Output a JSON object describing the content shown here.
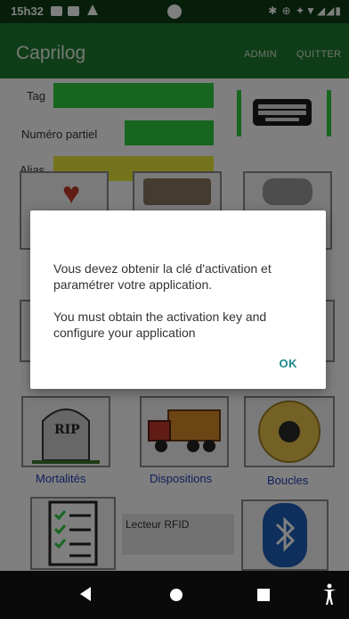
{
  "status_bar": {
    "time": "15h32"
  },
  "app_bar": {
    "title": "Caprilog",
    "admin_label": "ADMIN",
    "quit_label": "QUITTER"
  },
  "form": {
    "tag_label": "Tag",
    "partial_number_label": "Numéro partiel",
    "alias_label": "Alias"
  },
  "tiles": {
    "mortalities_label": "Mortalités",
    "dispositions_label": "Dispositions",
    "loops_label": "Boucles",
    "rfid_reader_label": "Lecteur RFID",
    "rip_text": "RIP"
  },
  "dialog": {
    "message_fr": "Vous devez obtenir la clé d'activation et paramétrer votre application.",
    "message_en": "You must obtain the activation key and configure your application",
    "ok_label": "OK"
  },
  "colors": {
    "accent": "#1f7a2e",
    "status_bar": "#0d3d14",
    "field_green": "#2ecc40",
    "field_yellow": "#e8e83a",
    "link_blue": "#1f3fb5",
    "dialog_button": "#1a8a8a"
  }
}
